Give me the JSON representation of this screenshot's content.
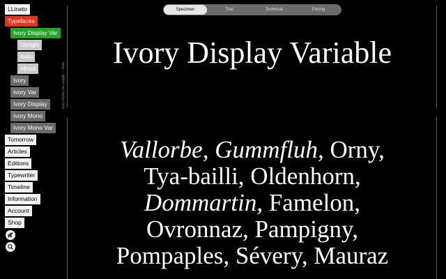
{
  "nav": {
    "items": [
      {
        "label": "LLineto"
      },
      {
        "label": "Typefaces"
      },
      {
        "label": "Ivory Display Var"
      },
      {
        "label": "Upright"
      },
      {
        "label": "Italic"
      },
      {
        "label": "About"
      },
      {
        "label": "Ivory"
      },
      {
        "label": "Ivory Var"
      },
      {
        "label": "Ivory Display"
      },
      {
        "label": "Ivory Mono"
      },
      {
        "label": "Ivory Mono Var"
      },
      {
        "label": "Tomorrow"
      },
      {
        "label": "Articles"
      },
      {
        "label": "Editions"
      },
      {
        "label": "Typewriter"
      },
      {
        "label": "Timeline"
      },
      {
        "label": "Information"
      },
      {
        "label": "Account"
      },
      {
        "label": "Shop"
      }
    ],
    "icons": [
      "no-sound-icon",
      "search-icon"
    ]
  },
  "vertical_label": "Ivory Display Var Upright — Slider",
  "tabs": [
    {
      "label": "Specimen"
    },
    {
      "label": "Trial"
    },
    {
      "label": "Technical"
    },
    {
      "label": "Pricing"
    }
  ],
  "title": "Ivory Display Variable",
  "specimen": {
    "segments": [
      {
        "text": "Vallorbe, Gummfluh,",
        "italic": true
      },
      {
        "text": " Orny,",
        "italic": false
      },
      {
        "text": "Tya-bailli, Oldenhorn,",
        "italic": false,
        "break_before": true
      },
      {
        "text": "Dommartin,",
        "italic": true,
        "break_before": true
      },
      {
        "text": " Famelon,",
        "italic": false
      },
      {
        "text": "Ovronnaz, Pampigny,",
        "italic": false,
        "break_before": true
      },
      {
        "text": "Pompaples, Sévery, Mauraz",
        "italic": false,
        "break_before": true
      }
    ]
  },
  "colors": {
    "background": "#000000",
    "accent_red": "#e8341c",
    "accent_green": "#24a526"
  }
}
